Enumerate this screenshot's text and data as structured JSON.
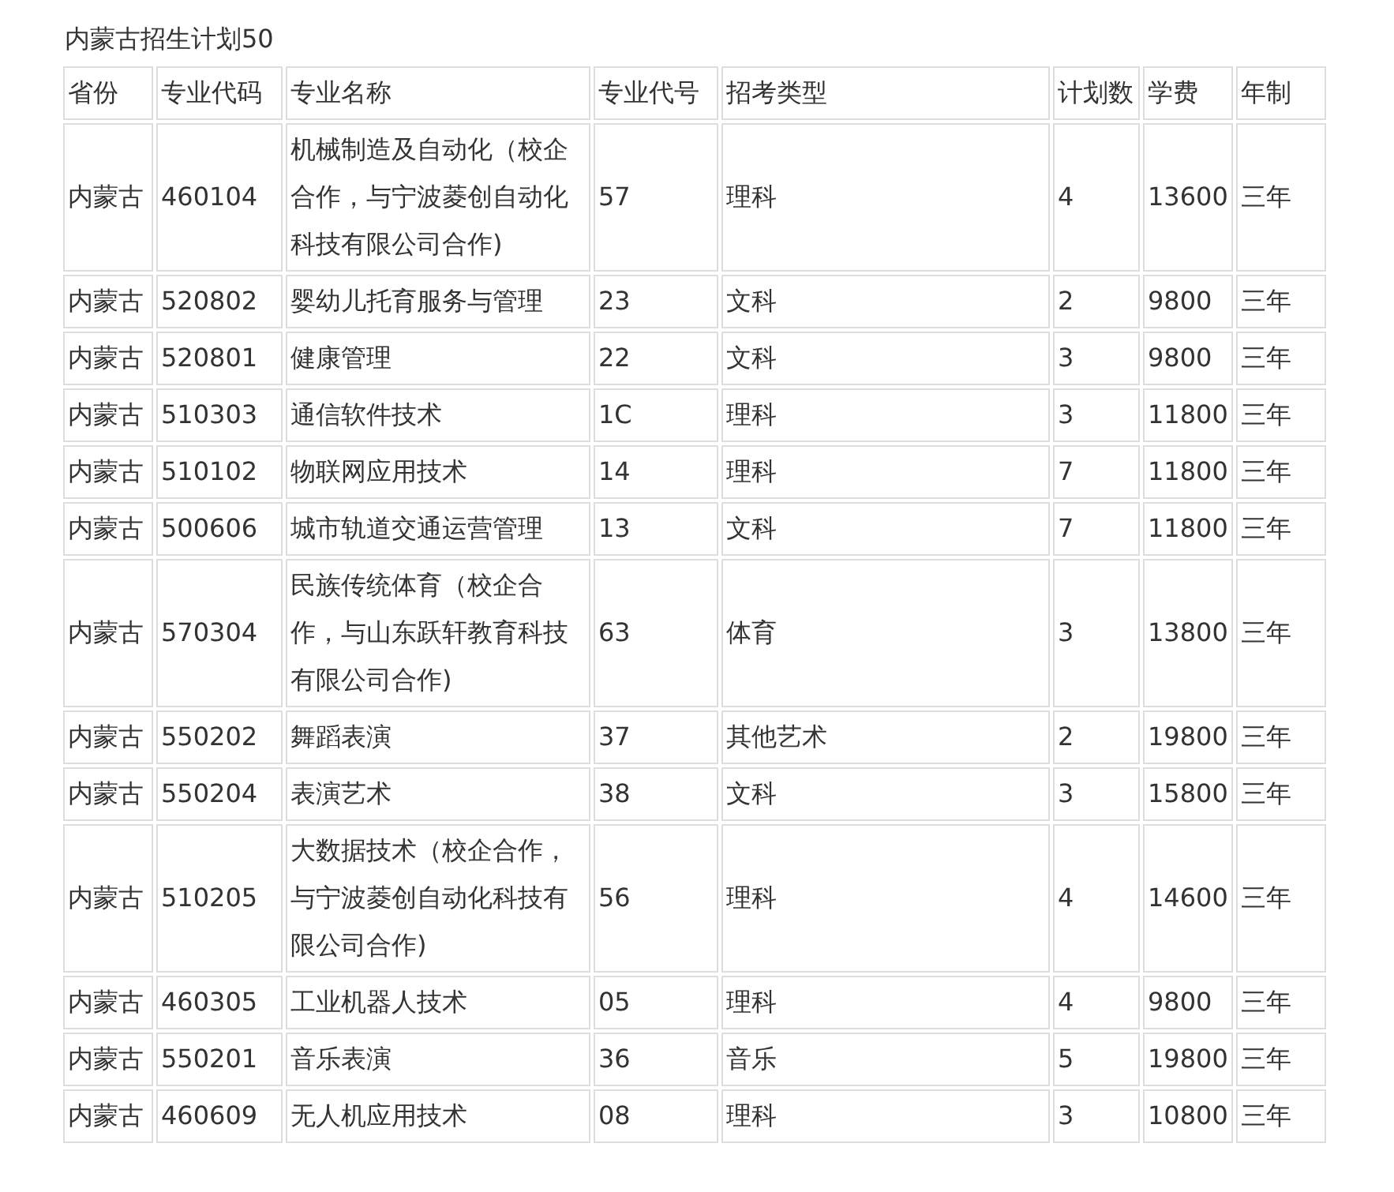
{
  "title": "内蒙古招生计划50",
  "table": {
    "columns": [
      "省份",
      "专业代码",
      "专业名称",
      "专业代号",
      "招考类型",
      "计划数",
      "学费",
      "年制"
    ],
    "rows": [
      [
        "内蒙古",
        "460104",
        "机械制造及自动化（校企合作，与宁波菱创自动化科技有限公司合作)",
        "57",
        "理科",
        "4",
        "13600",
        "三年"
      ],
      [
        "内蒙古",
        "520802",
        "婴幼儿托育服务与管理",
        "23",
        "文科",
        "2",
        "9800",
        "三年"
      ],
      [
        "内蒙古",
        "520801",
        "健康管理",
        "22",
        "文科",
        "3",
        "9800",
        "三年"
      ],
      [
        "内蒙古",
        "510303",
        "通信软件技术",
        "1C",
        "理科",
        "3",
        "11800",
        "三年"
      ],
      [
        "内蒙古",
        "510102",
        "物联网应用技术",
        "14",
        "理科",
        "7",
        "11800",
        "三年"
      ],
      [
        "内蒙古",
        "500606",
        "城市轨道交通运营管理",
        "13",
        "文科",
        "7",
        "11800",
        "三年"
      ],
      [
        "内蒙古",
        "570304",
        "民族传统体育（校企合作，与山东跃轩教育科技有限公司合作)",
        "63",
        "体育",
        "3",
        "13800",
        "三年"
      ],
      [
        "内蒙古",
        "550202",
        "舞蹈表演",
        "37",
        "其他艺术",
        "2",
        "19800",
        "三年"
      ],
      [
        "内蒙古",
        "550204",
        "表演艺术",
        "38",
        "文科",
        "3",
        "15800",
        "三年"
      ],
      [
        "内蒙古",
        "510205",
        "大数据技术（校企合作，与宁波菱创自动化科技有限公司合作)",
        "56",
        "理科",
        "4",
        "14600",
        "三年"
      ],
      [
        "内蒙古",
        "460305",
        "工业机器人技术",
        "05",
        "理科",
        "4",
        "9800",
        "三年"
      ],
      [
        "内蒙古",
        "550201",
        "音乐表演",
        "36",
        "音乐",
        "5",
        "19800",
        "三年"
      ],
      [
        "内蒙古",
        "460609",
        "无人机应用技术",
        "08",
        "理科",
        "3",
        "10800",
        "三年"
      ]
    ]
  }
}
